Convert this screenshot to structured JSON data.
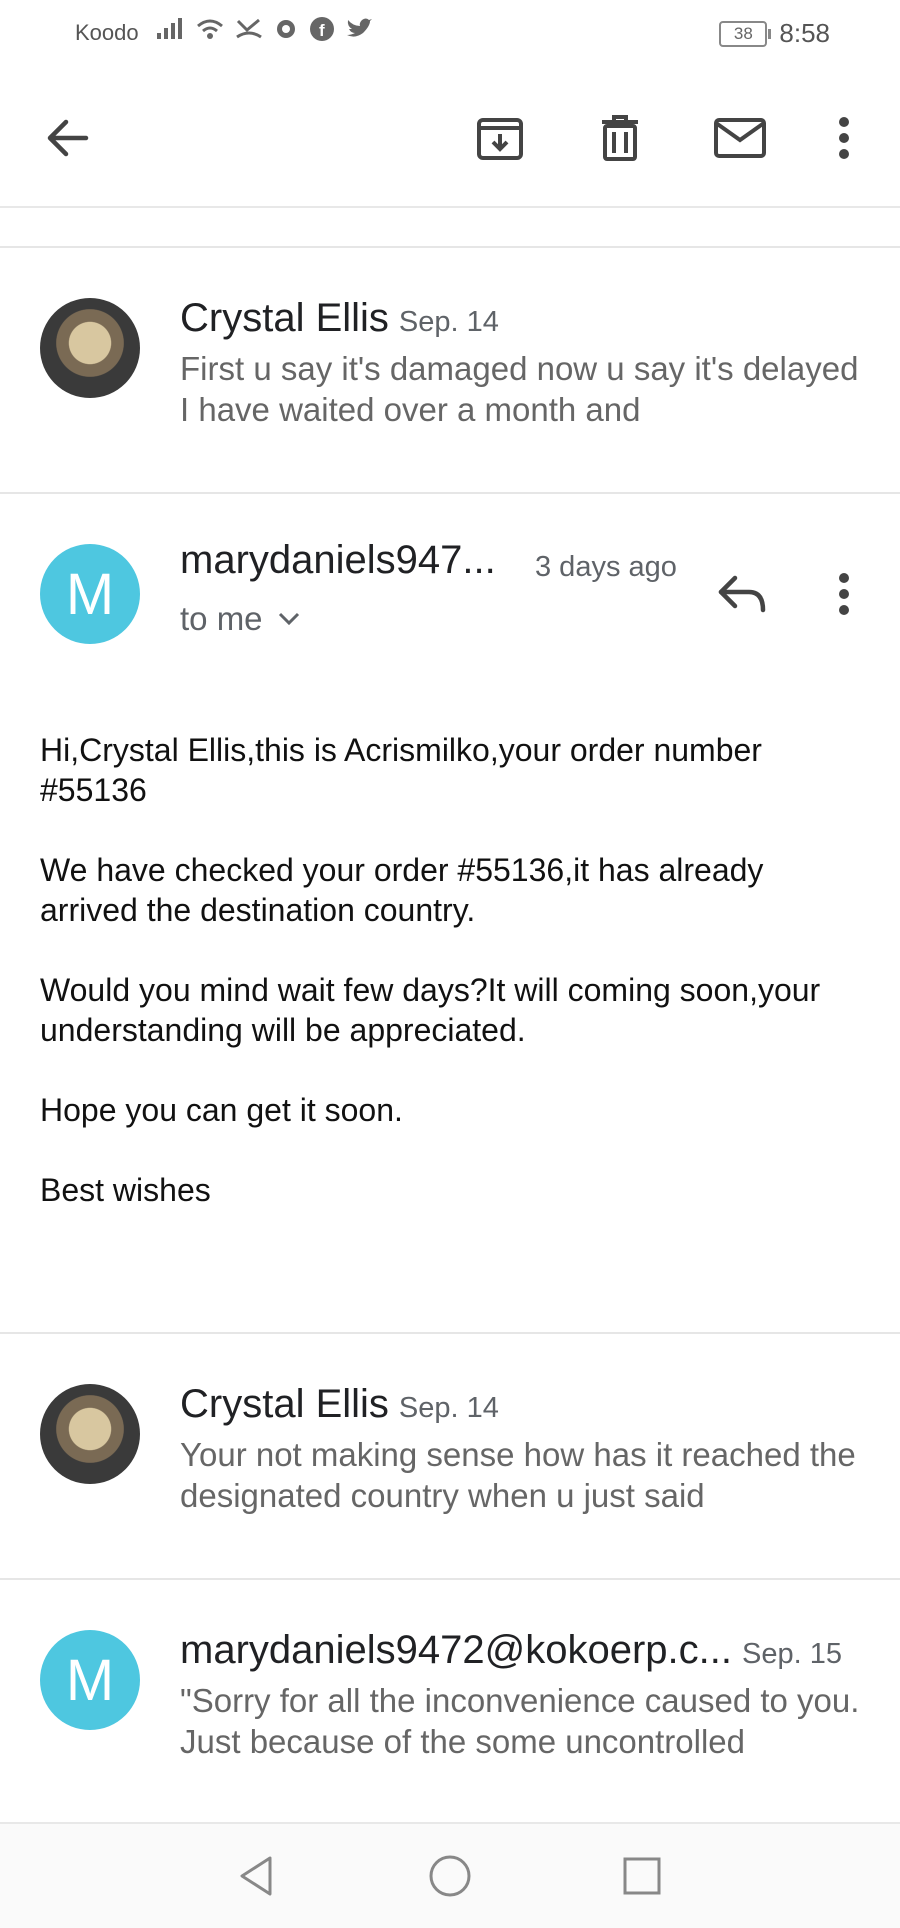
{
  "status_bar": {
    "carrier": "Koodo",
    "battery": "38",
    "time": "8:58"
  },
  "toolbar": {
    "icons": [
      "back-arrow-icon",
      "archive-icon",
      "delete-icon",
      "mark-unread-icon",
      "more-vert-icon"
    ]
  },
  "threads": [
    {
      "sender": "Crystal Ellis",
      "date": "Sep. 14",
      "snippet": "First u say it's damaged now u say it's delayed I have waited over a month and",
      "avatar": "photo"
    },
    {
      "sender": "Crystal Ellis",
      "date": "Sep. 14",
      "snippet": "Your not making sense how has it reached the designated country when u just said",
      "avatar": "photo"
    },
    {
      "sender": "marydaniels9472@kokoerp.c...",
      "date": "Sep. 15",
      "snippet": "\"Sorry for all the inconvenience caused to you. Just because of the some uncontrolled",
      "avatar_letter": "M"
    }
  ],
  "open_email": {
    "sender": "marydaniels947...",
    "time": "3 days ago",
    "recipient_label": "to me",
    "avatar_letter": "M",
    "paragraphs": [
      "Hi,Crystal Ellis,this is Acrismilko,your order number #55136",
      "We have checked your order #55136,it has already arrived the destination country.",
      "Would you mind wait few days?It will coming soon,your understanding will be appreciated.",
      "Hope you can get it soon.",
      "Best wishes"
    ]
  },
  "colors": {
    "avatar_blue": "#4ec7e0",
    "divider": "#e6e6e6"
  }
}
